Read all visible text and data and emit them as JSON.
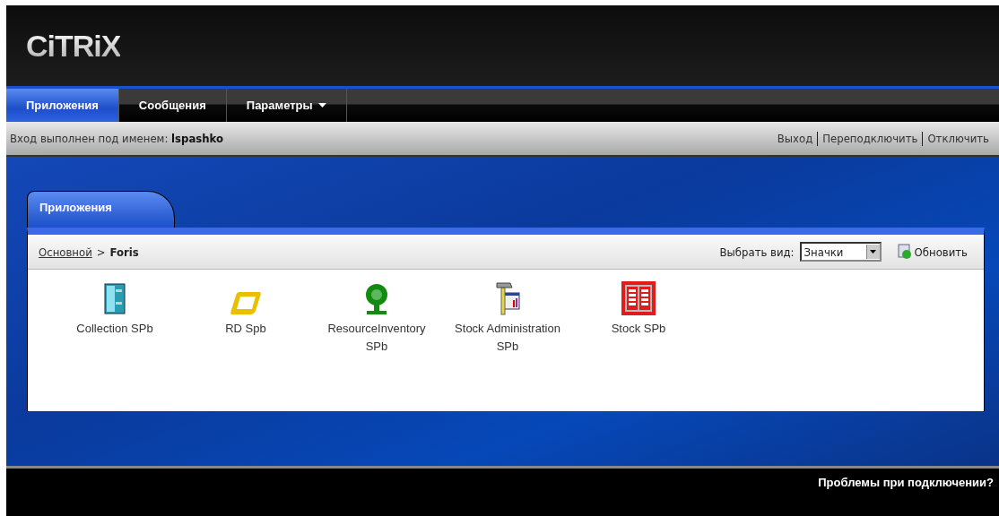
{
  "logo": "CiTRiX",
  "nav": [
    {
      "label": "Приложения",
      "selected": true,
      "dropdown": false
    },
    {
      "label": "Сообщения",
      "selected": false,
      "dropdown": false
    },
    {
      "label": "Параметры",
      "selected": false,
      "dropdown": true
    }
  ],
  "login": {
    "label": "Вход выполнен под именем:",
    "user": "lspashko"
  },
  "actions": [
    "Выход",
    "Переподключить",
    "Отключить"
  ],
  "panel": {
    "tab": "Приложения",
    "breadcrumb": {
      "link": "Основной",
      "separator": ">",
      "current": "Foris"
    },
    "view": {
      "label": "Выбрать вид:",
      "value": "Значки"
    },
    "refresh": "Обновить",
    "apps": [
      {
        "name": "Collection SPb",
        "kind": "cabinet"
      },
      {
        "name": "RD Spb",
        "kind": "ring"
      },
      {
        "name": "ResourceInventory SPb",
        "kind": "tree"
      },
      {
        "name": "Stock Administration SPb",
        "kind": "hammer"
      },
      {
        "name": "Stock SPb",
        "kind": "book"
      }
    ]
  },
  "footer": {
    "link": "Проблемы при подключении?"
  }
}
